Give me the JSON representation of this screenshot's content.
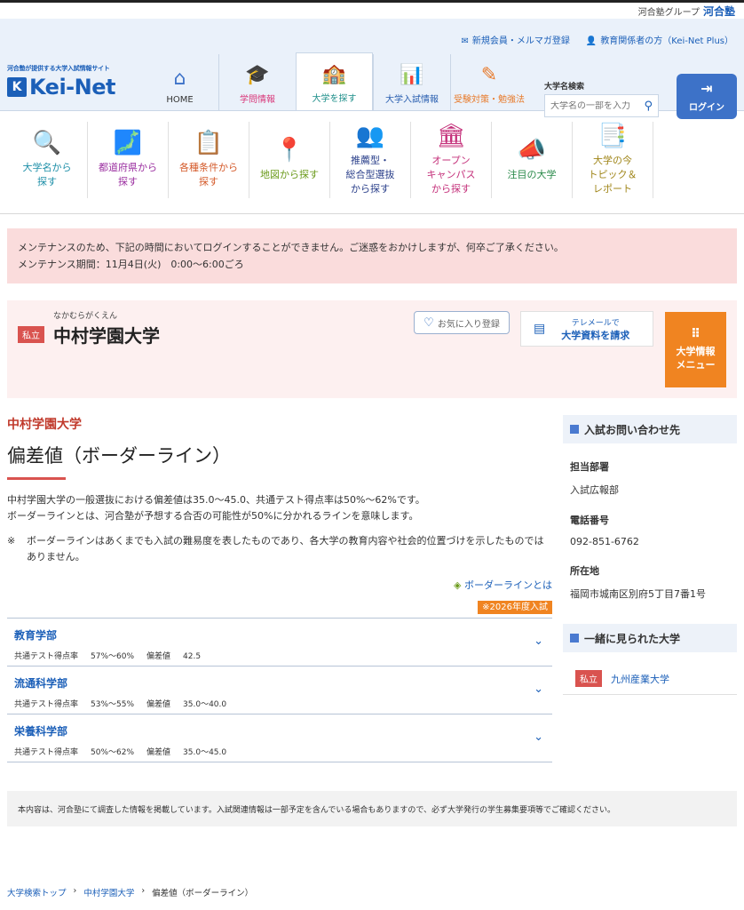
{
  "group": {
    "label": "河合塾グループ",
    "brand": "河合塾"
  },
  "util_links": [
    {
      "icon": "mail-icon",
      "label": "新規会員・メルマガ登録"
    },
    {
      "icon": "person-icon",
      "label": "教育関係者の方（Kei-Net Plus）"
    }
  ],
  "logo": {
    "tagline": "河合塾が提供する大学入試情報サイト",
    "name": "Kei-Net"
  },
  "nav": [
    {
      "label": "HOME",
      "icon": "home-icon",
      "color": "#3d72c8"
    },
    {
      "label": "学問情報",
      "icon": "graduation-cap-icon",
      "color": "#d9387a"
    },
    {
      "label": "大学を探す",
      "icon": "school-search-icon",
      "color": "#2aa6a0",
      "active": true
    },
    {
      "label": "大学入試情報",
      "icon": "bar-chart-icon",
      "color": "#2a5fb0"
    },
    {
      "label": "受験対策・勉強法",
      "icon": "pencil-icon",
      "color": "#e87a2a"
    }
  ],
  "search": {
    "label": "大学名検索",
    "placeholder": "大学名の一部を入力"
  },
  "login": {
    "label": "ログイン"
  },
  "sub_nav": [
    {
      "icon": "magnifier-icon",
      "line1": "大学名から",
      "line2": "探す",
      "line3": "",
      "color": "#1e8fa8"
    },
    {
      "icon": "japan-map-icon",
      "line1": "都道府県から",
      "line2": "探す",
      "line3": "",
      "color": "#9b2fa0"
    },
    {
      "icon": "checklist-icon",
      "line1": "各種条件から",
      "line2": "探す",
      "line3": "",
      "color": "#d45a2a"
    },
    {
      "icon": "map-pin-icon",
      "line1": "地図から探す",
      "line2": "",
      "line3": "",
      "color": "#6a9a1a"
    },
    {
      "icon": "interview-icon",
      "line1": "推薦型・",
      "line2": "総合型選抜",
      "line3": "から探す",
      "color": "#2a3f8a"
    },
    {
      "icon": "open-campus-icon",
      "line1": "オープン",
      "line2": "キャンパス",
      "line3": "から探す",
      "color": "#c4307a"
    },
    {
      "icon": "megaphone-icon",
      "line1": "注目の大学",
      "line2": "",
      "line3": "",
      "color": "#2a8a4a"
    },
    {
      "icon": "report-icon",
      "line1": "大学の今",
      "line2": "トピック＆",
      "line3": "レポート",
      "color": "#a0861a"
    }
  ],
  "notice": {
    "line1": "メンテナンスのため、下記の時間においてログインすることができません。ご迷惑をおかけしますが、何卒ご了承ください。",
    "line2": "メンテナンス期間：11月4日(火)　0:00〜6:00ごろ"
  },
  "univ": {
    "kana": "なかむらがくえん",
    "type": "私立",
    "name": "中村学園大学",
    "fav_label": "お気に入り登録",
    "doc_line1": "テレメールで",
    "doc_line2": "大学資料を請求",
    "menu_line1": "大学情報",
    "menu_line2": "メニュー"
  },
  "main": {
    "univ_sub": "中村学園大学",
    "title": "偏差値（ボーダーライン）",
    "desc1": "中村学園大学の一般選抜における偏差値は35.0〜45.0、共通テスト得点率は50%〜62%です。",
    "desc2": "ボーダーラインとは、河合塾が予想する合否の可能性が50%に分かれるラインを意味します。",
    "note_mark": "※",
    "note": "ボーダーラインはあくまでも入試の難易度を表したものであり、各大学の教育内容や社会的位置づけを示したものではありません。",
    "border_link": "ボーダーラインとは",
    "year_badge": "※2026年度入試"
  },
  "faculties": [
    {
      "name": "教育学部",
      "rate_label": "共通テスト得点率",
      "rate": "57%〜60%",
      "dev_label": "偏差値",
      "dev": "42.5"
    },
    {
      "name": "流通科学部",
      "rate_label": "共通テスト得点率",
      "rate": "53%〜55%",
      "dev_label": "偏差値",
      "dev": "35.0〜40.0"
    },
    {
      "name": "栄養科学部",
      "rate_label": "共通テスト得点率",
      "rate": "50%〜62%",
      "dev_label": "偏差値",
      "dev": "35.0〜45.0"
    }
  ],
  "side": {
    "contact_title": "入試お問い合わせ先",
    "dept_label": "担当部署",
    "dept": "入試広報部",
    "tel_label": "電話番号",
    "tel": "092-851-6762",
    "addr_label": "所在地",
    "addr": "福岡市城南区別府5丁目7番1号",
    "related_title": "一緒に見られた大学",
    "related_type": "私立",
    "related_name": "九州産業大学"
  },
  "footer_note": "本内容は、河合塾にて調査した情報を掲載しています。入試関連情報は一部予定を含んでいる場合もありますので、必ず大学発行の学生募集要項等でご確認ください。",
  "breadcrumb": [
    "大学検索トップ",
    "中村学園大学",
    "偏差値（ボーダーライン）"
  ]
}
